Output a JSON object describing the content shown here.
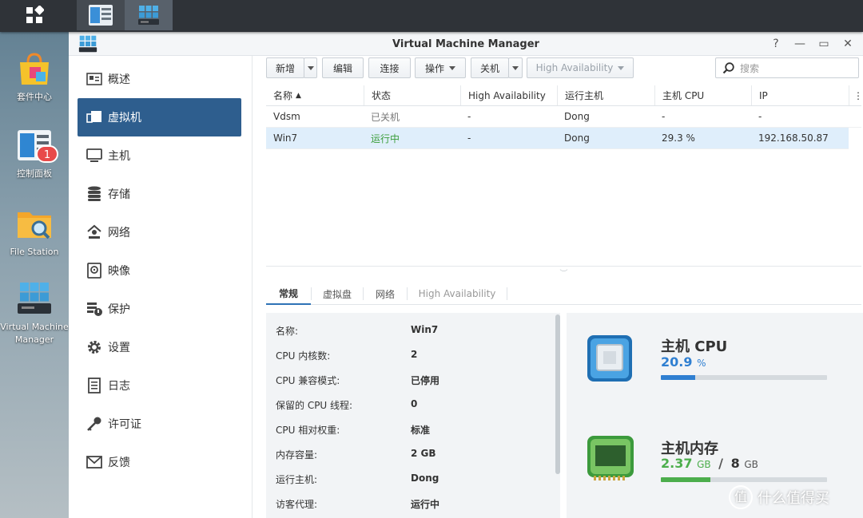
{
  "desktop": {
    "icons": [
      {
        "label": "套件中心",
        "icon": "package-center-icon"
      },
      {
        "label": "控制面板",
        "icon": "control-panel-icon",
        "badge": "1"
      },
      {
        "label": "File Station",
        "icon": "file-station-icon"
      },
      {
        "label": "Virtual Machine",
        "label2": "Manager",
        "icon": "vmm-icon"
      }
    ]
  },
  "taskbar": {
    "apps": [
      {
        "icon": "control-panel-icon"
      },
      {
        "icon": "vmm-icon"
      }
    ]
  },
  "window": {
    "title": "Virtual Machine Manager",
    "controls": {
      "help": "?",
      "minimize": "—",
      "maximize": "▭",
      "close": "✕"
    }
  },
  "sidebar": {
    "items": [
      {
        "label": "概述",
        "icon": "overview-icon"
      },
      {
        "label": "虚拟机",
        "icon": "virtual-machine-icon",
        "selected": true
      },
      {
        "label": "主机",
        "icon": "host-icon"
      },
      {
        "label": "存储",
        "icon": "storage-icon"
      },
      {
        "label": "网络",
        "icon": "network-icon"
      },
      {
        "label": "映像",
        "icon": "image-icon"
      },
      {
        "label": "保护",
        "icon": "protection-icon"
      },
      {
        "label": "设置",
        "icon": "settings-icon"
      },
      {
        "label": "日志",
        "icon": "log-icon"
      },
      {
        "label": "许可证",
        "icon": "license-icon"
      },
      {
        "label": "反馈",
        "icon": "feedback-icon"
      }
    ]
  },
  "toolbar": {
    "create": "新增",
    "edit": "编辑",
    "connect": "连接",
    "action": "操作",
    "shutdown": "关机",
    "ha": "High Availability",
    "search_placeholder": "搜索"
  },
  "grid": {
    "columns": [
      "名称",
      "状态",
      "High Availability",
      "运行主机",
      "主机 CPU",
      "IP"
    ],
    "sort_column": "名称",
    "rows": [
      {
        "name": "Vdsm",
        "status": "已关机",
        "ha": "-",
        "host": "Dong",
        "cpu": "-",
        "ip": "-",
        "selected": false
      },
      {
        "name": "Win7",
        "status": "运行中",
        "ha": "-",
        "host": "Dong",
        "cpu": "29.3 %",
        "ip": "192.168.50.87",
        "selected": true
      }
    ]
  },
  "detail_tabs": [
    {
      "label": "常规",
      "selected": true
    },
    {
      "label": "虚拟盘"
    },
    {
      "label": "网络"
    },
    {
      "label": "High Availability",
      "disabled": true
    }
  ],
  "details": [
    {
      "label": "名称:",
      "value": "Win7"
    },
    {
      "label": "CPU 内核数:",
      "value": "2"
    },
    {
      "label": "CPU 兼容模式:",
      "value": "已停用"
    },
    {
      "label": "保留的 CPU 线程:",
      "value": "0"
    },
    {
      "label": "CPU 相对权重:",
      "value": "标准"
    },
    {
      "label": "内存容量:",
      "value": "2 GB"
    },
    {
      "label": "运行主机:",
      "value": "Dong"
    },
    {
      "label": "访客代理:",
      "value": "运行中"
    }
  ],
  "host_cpu": {
    "title": "主机 CPU",
    "value": "20.9",
    "unit": "%",
    "fraction": 0.209,
    "color": "#2f7fd1"
  },
  "host_memory": {
    "title": "主机内存",
    "used": "2.37",
    "used_unit": "GB",
    "sep": "/",
    "total": "8",
    "total_unit": "GB",
    "fraction": 0.296,
    "color": "#4cae4c"
  },
  "watermark": {
    "text": "什么值得买",
    "logo": "值"
  }
}
